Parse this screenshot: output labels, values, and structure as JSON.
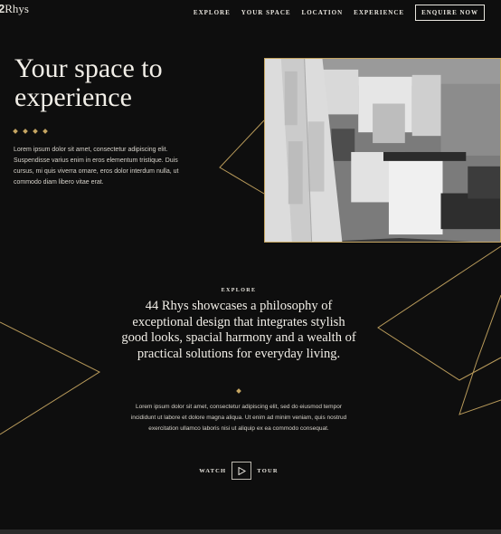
{
  "brand": {
    "logo_prefix": "2",
    "logo_name": "Rhys"
  },
  "nav": {
    "items": [
      "EXPLORE",
      "YOUR SPACE",
      "LOCATION",
      "EXPERIENCE"
    ],
    "cta": "ENQUIRE NOW"
  },
  "hero": {
    "title_line1": "Your space to",
    "title_line2": "experience",
    "body": "Lorem ipsum dolor sit amet, consectetur adipiscing elit. Suspendisse varius enim in eros elementum tristique. Duis cursus, mi quis viverra ornare, eros dolor interdum nulla, ut commodo diam libero vitae erat."
  },
  "explore": {
    "label": "EXPLORE",
    "tagline": "44 Rhys showcases a philosophy of exceptional design that integrates stylish good looks, spacial harmony and a wealth of practical solutions for everyday living.",
    "body": "Lorem ipsum dolor sit amet, consectetur adipiscing elit, sed do eiusmod tempor incididunt ut labore et dolore magna aliqua. Ut enim ad minim veniam, quis nostrud exercitation ullamco laboris nisi ut aliquip ex ea commodo consequat."
  },
  "watch": {
    "left": "WATCH",
    "right": "TOUR"
  },
  "icons": {
    "play": "play-icon",
    "diamond": "diamond-icon"
  },
  "colors": {
    "background": "#0e0e0e",
    "accent_gold": "#c6a662",
    "text": "#e9e6df"
  }
}
